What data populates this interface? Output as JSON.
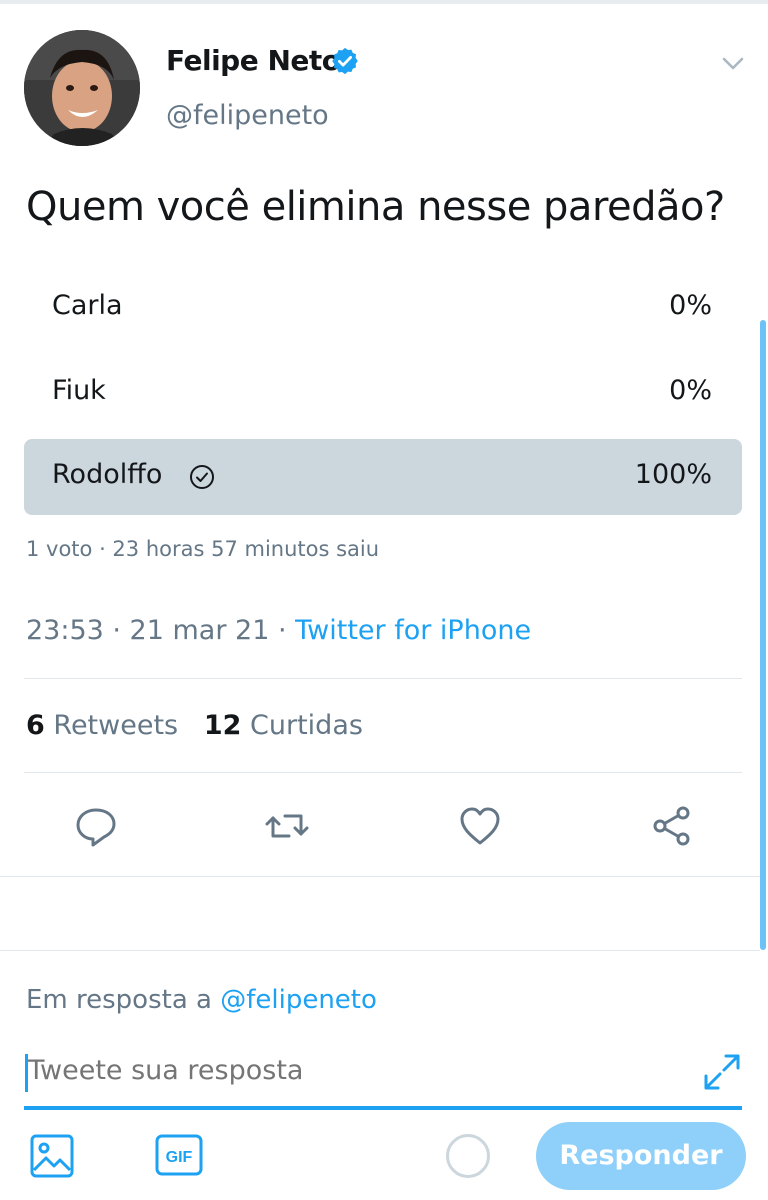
{
  "tweet": {
    "author_name": "Felipe Neto",
    "author_handle": "@felipeneto",
    "question": "Quem você elimina nesse paredão?",
    "poll": {
      "options": [
        {
          "label": "Carla",
          "percent_text": "0%",
          "percent": 0
        },
        {
          "label": "Fiuk",
          "percent_text": "0%",
          "percent": 0
        },
        {
          "label": "Rodolffo",
          "percent_text": "100%",
          "percent": 100,
          "voted": true
        }
      ],
      "meta": "1 voto · 23 horas 57 minutos saiu"
    },
    "timestamp": "23:53 · 21 mar 21 · ",
    "source": "Twitter for iPhone",
    "stats": {
      "retweets_count": "6",
      "retweets_label": "Retweets",
      "likes_count": "12",
      "likes_label": "Curtidas"
    }
  },
  "reply": {
    "in_reply_to_prefix": "Em resposta a ",
    "in_reply_to_handle": "@felipeneto",
    "placeholder": "Tweete sua resposta",
    "submit_label": "Responder"
  },
  "icons": {
    "verified": "verified-badge-icon",
    "menu": "chevron-down-icon",
    "actions": [
      "reply-icon",
      "retweet-icon",
      "like-icon",
      "share-icon"
    ],
    "composer": [
      "image-icon",
      "gif-icon",
      "character-counter",
      "expand-icon"
    ]
  },
  "colors": {
    "accent": "#1da1f2",
    "muted": "#657786",
    "poll_fill": "#ccd6dd",
    "button_disabled": "#8ed0f9"
  }
}
